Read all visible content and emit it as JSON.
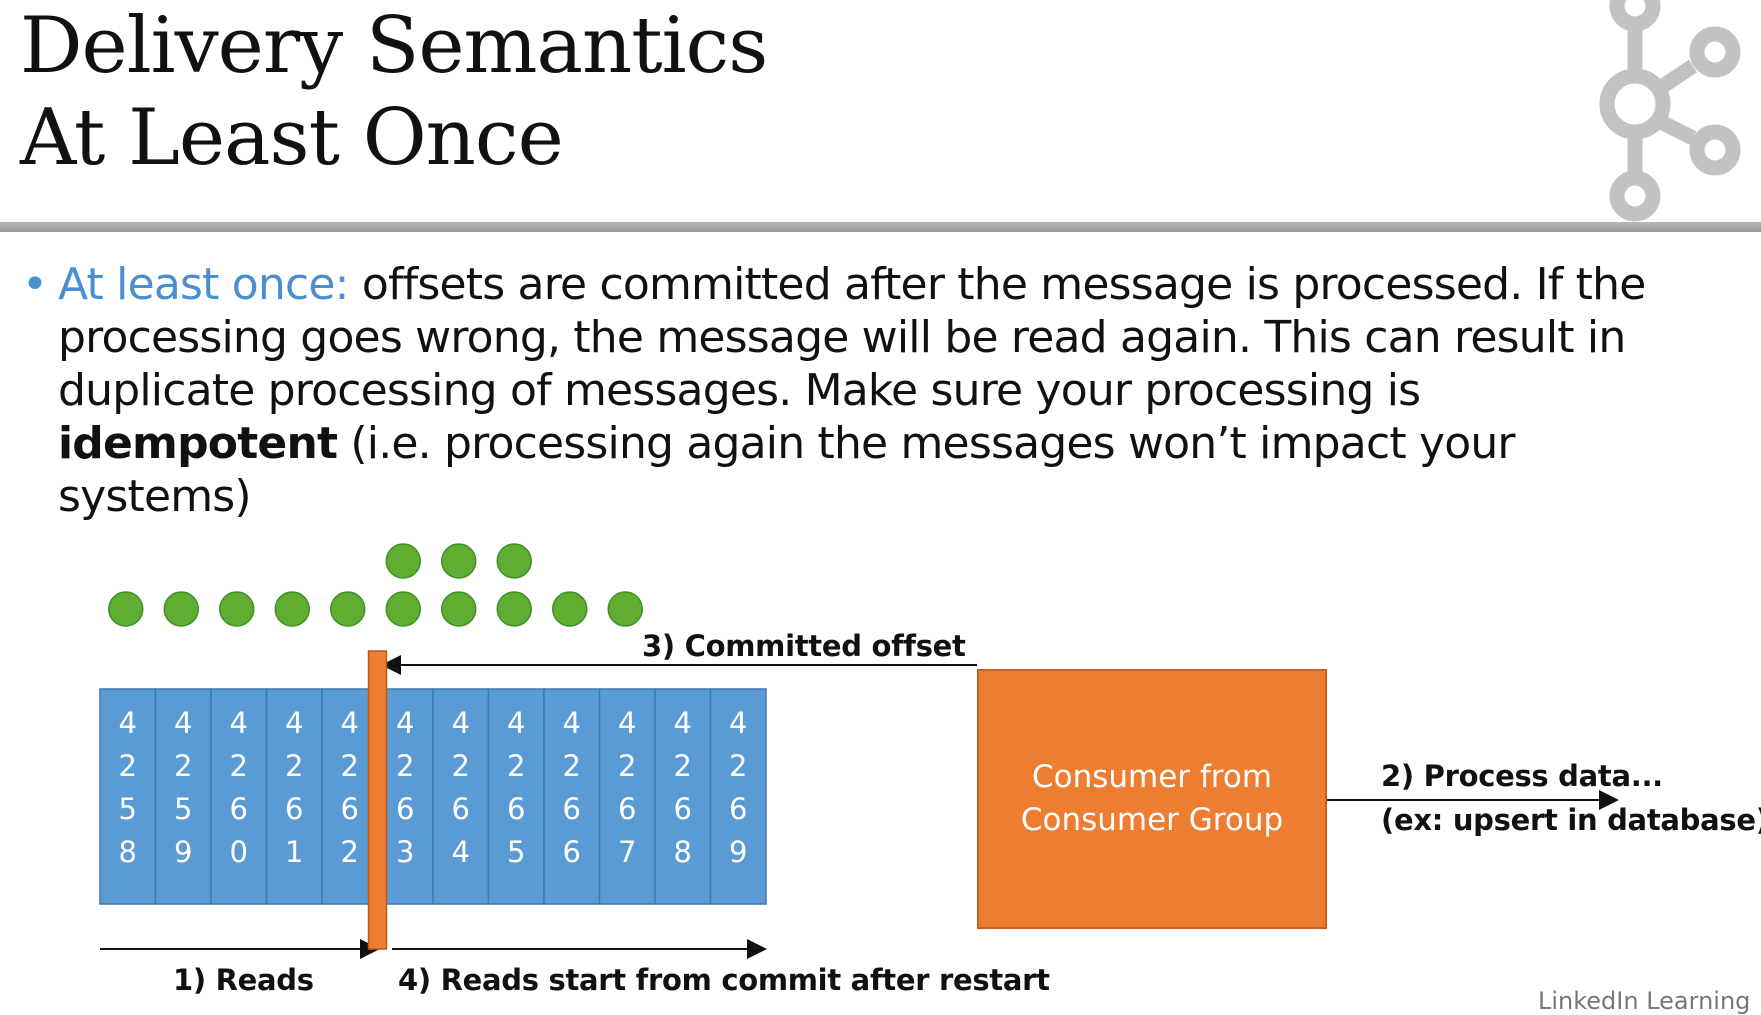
{
  "slide": {
    "title_line1": "Delivery Semantics",
    "title_line2": "At Least Once",
    "bullet": {
      "lead": "At least once:",
      "text_before_bold": " offsets are committed after the message is processed. If the processing goes wrong, the message will be read again. This can result in duplicate processing of messages. Make sure your processing is ",
      "bold": "idempotent",
      "text_after_bold": " (i.e. processing again the messages won’t impact your systems)"
    }
  },
  "diagram": {
    "offsets": [
      "4258",
      "4259",
      "4260",
      "4261",
      "4262",
      "4263",
      "4264",
      "4265",
      "4266",
      "4267",
      "4268",
      "4269"
    ],
    "dots_per_offset": [
      1,
      1,
      1,
      1,
      1,
      2,
      2,
      2,
      1,
      1,
      0,
      0
    ],
    "committed_index": 5,
    "consumer_label_line1": "Consumer from",
    "consumer_label_line2": "Consumer Group",
    "label_reads": "1) Reads",
    "label_process_line1": "2) Process data...",
    "label_process_line2": "(ex: upsert in database)",
    "label_committed": "3) Committed offset",
    "label_restart": "4) Reads start from commit after restart"
  },
  "colors": {
    "cell_blue": "#5b9bd5",
    "commit_orange": "#ed7d31",
    "dot_green": "#5fae32",
    "accent_blue": "#4a90d0"
  },
  "watermark": "LinkedIn Learning"
}
